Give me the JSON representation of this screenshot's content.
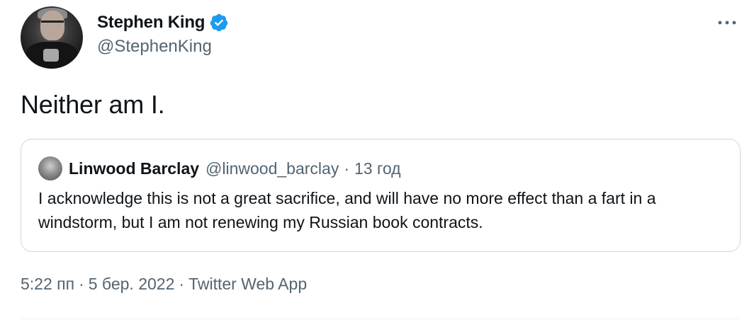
{
  "author": {
    "name": "Stephen King",
    "handle": "@StephenKing",
    "verified": true
  },
  "tweet": {
    "text": "Neither am I."
  },
  "quoted_tweet": {
    "name": "Linwood Barclay",
    "handle": "@linwood_barclay",
    "separator": "·",
    "time": "13 год",
    "text": "I acknowledge this is not a great sacrifice, and will have no more effect than a fart in a windstorm, but I am not renewing my Russian book contracts."
  },
  "meta": {
    "time": "5:22 пп",
    "date": "5 бер. 2022",
    "source": "Twitter Web App",
    "separator": "·"
  },
  "icons": {
    "verified": "verified-badge-icon",
    "more": "more-options-icon"
  },
  "colors": {
    "text_primary": "#0f1419",
    "text_secondary": "#536471",
    "verified_blue": "#1d9bf0",
    "border": "#cfd9de"
  }
}
